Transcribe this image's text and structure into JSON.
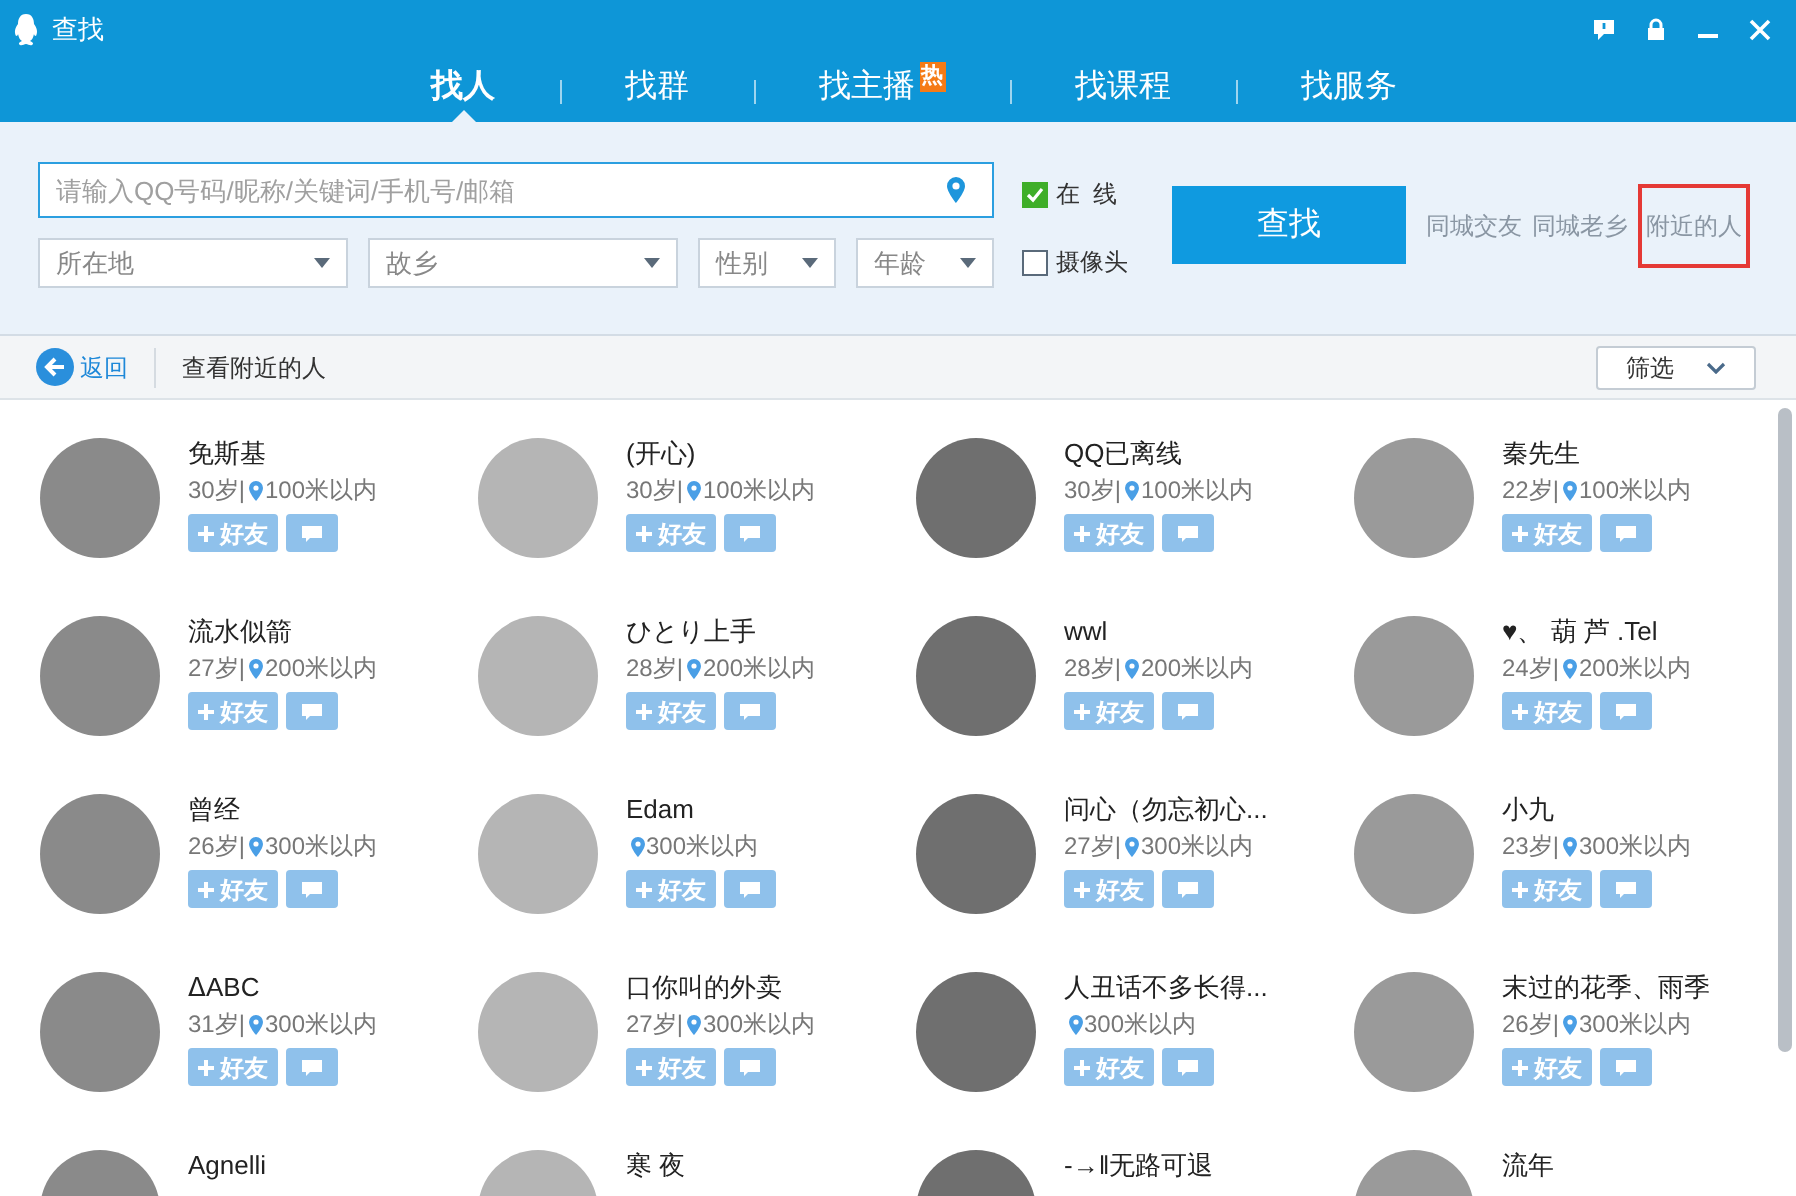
{
  "window": {
    "title": "查找"
  },
  "tabs": [
    {
      "label": "找人",
      "selected": true
    },
    {
      "label": "找群",
      "selected": false
    },
    {
      "label": "找主播",
      "selected": false,
      "badge": "热"
    },
    {
      "label": "找课程",
      "selected": false
    },
    {
      "label": "找服务",
      "selected": false
    }
  ],
  "search": {
    "placeholder": "请输入QQ号码/昵称/关键词/手机号/邮箱",
    "button": "查找"
  },
  "filters": [
    {
      "label": "所在地"
    },
    {
      "label": "故乡"
    },
    {
      "label": "性别"
    },
    {
      "label": "年龄"
    }
  ],
  "options": [
    {
      "label": "在  线",
      "checked": true
    },
    {
      "label": "摄像头",
      "checked": false
    }
  ],
  "quick_links": [
    {
      "label": "同城交友",
      "highlighted": false
    },
    {
      "label": "同城老乡",
      "highlighted": false
    },
    {
      "label": "附近的人",
      "highlighted": true
    }
  ],
  "toolbar": {
    "back": "返回",
    "title": "查看附近的人",
    "filter": "筛选"
  },
  "people": [
    {
      "name": "免斯基",
      "age": "30岁|",
      "distance": "100米以内",
      "add_button": "好友"
    },
    {
      "name": "(开心)",
      "age": "30岁|",
      "distance": "100米以内",
      "add_button": "好友"
    },
    {
      "name": "QQ已离线",
      "age": "30岁|",
      "distance": "100米以内",
      "add_button": "好友"
    },
    {
      "name": "秦先生",
      "age": "22岁|",
      "distance": "100米以内",
      "add_button": "好友"
    },
    {
      "name": "流水似箭",
      "age": "27岁|",
      "distance": "200米以内",
      "add_button": "好友"
    },
    {
      "name": "ひとり上手",
      "age": "28岁|",
      "distance": "200米以内",
      "add_button": "好友"
    },
    {
      "name": "wwl",
      "age": "28岁|",
      "distance": "200米以内",
      "add_button": "好友"
    },
    {
      "name": "♥、 葫 芦 .Tel",
      "age": "24岁|",
      "distance": "200米以内",
      "add_button": "好友"
    },
    {
      "name": "曾经",
      "age": "26岁|",
      "distance": "300米以内",
      "add_button": "好友"
    },
    {
      "name": "Edam",
      "distance": "300米以内",
      "add_button": "好友"
    },
    {
      "name": "问心（勿忘初心...",
      "age": "27岁|",
      "distance": "300米以内",
      "add_button": "好友"
    },
    {
      "name": "小九",
      "age": "23岁|",
      "distance": "300米以内",
      "add_button": "好友"
    },
    {
      "name": "ᐃABC",
      "age": "31岁|",
      "distance": "300米以内",
      "add_button": "好友"
    },
    {
      "name": "口你叫的外卖",
      "age": "27岁|",
      "distance": "300米以内",
      "add_button": "好友"
    },
    {
      "name": "人丑话不多长得...",
      "distance": "300米以内",
      "add_button": "好友"
    },
    {
      "name": "末过的花季、雨季",
      "age": "26岁|",
      "distance": "300米以内",
      "add_button": "好友"
    },
    {
      "name": "Agnelli"
    },
    {
      "name": "寒 夜"
    },
    {
      "name": "-→‖无路可退"
    },
    {
      "name": "流年"
    }
  ]
}
